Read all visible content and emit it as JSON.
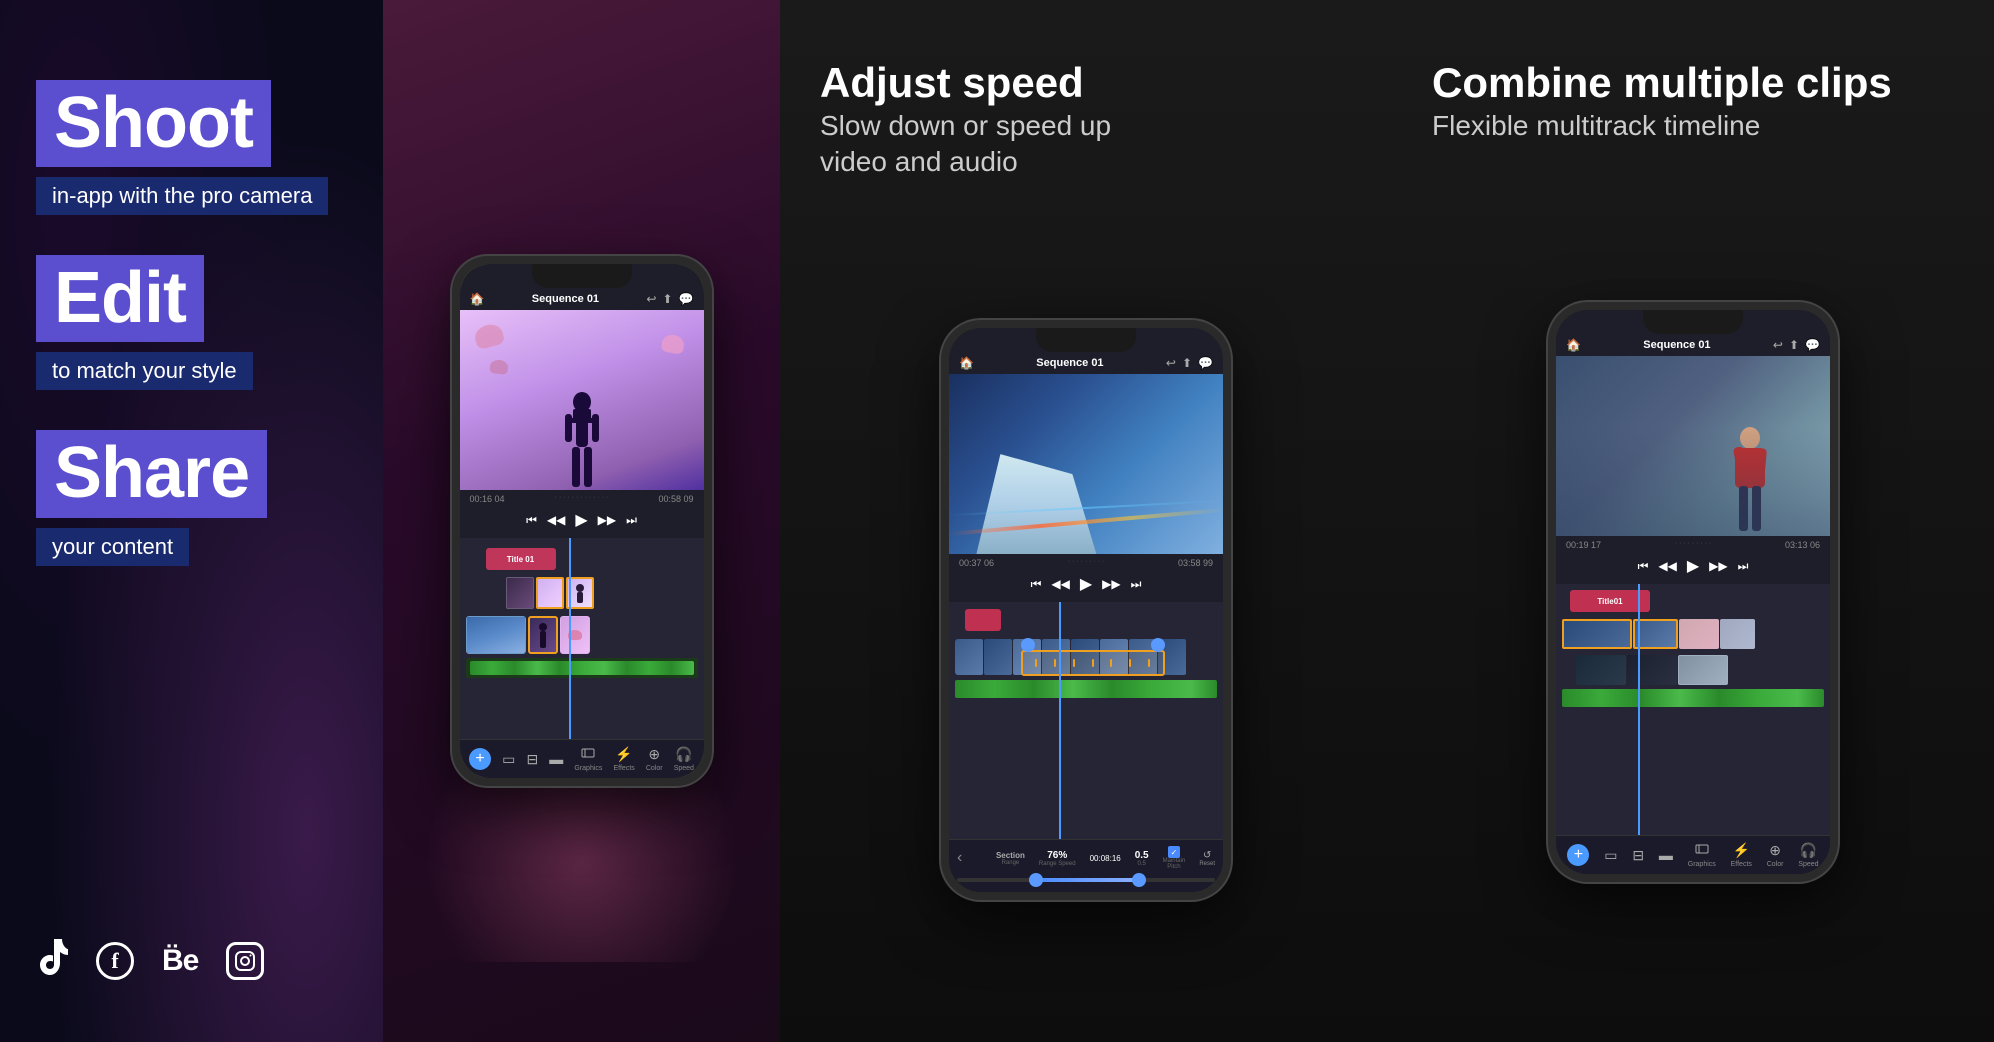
{
  "panel1": {
    "hero1_label": "Shoot",
    "hero1_sub": "in-app with the pro camera",
    "hero2_label": "Edit",
    "hero2_sub": "to match your style",
    "hero3_label": "Share",
    "hero3_sub": "your content",
    "social_icons": [
      "tiktok",
      "facebook",
      "behance",
      "instagram"
    ]
  },
  "panel2": {
    "phone": {
      "header_title": "Sequence 01",
      "time_display": "00:16 04",
      "duration_display": "00:58 09",
      "title_track": "Title 01",
      "toolbar_items": [
        "Graphics",
        "Effects",
        "Color",
        "Speed"
      ]
    }
  },
  "panel3": {
    "title_bold": "Adjust speed",
    "title_light1": "Slow down or speed up",
    "title_light2": "video and audio",
    "phone": {
      "header_title": "Sequence 01",
      "time_display": "00:37 06",
      "duration_display": "03:58 99",
      "section_label": "Section",
      "range_label": "Range",
      "speed_value": "76%",
      "time2": "00:08:16",
      "ramp_value": "0.5",
      "maintain_pitch_label": "Maintain Pitch",
      "reset_label": "Reset"
    }
  },
  "panel4": {
    "title_bold": "Combine multiple clips",
    "title_light": "Flexible multitrack timeline",
    "phone": {
      "header_title": "Sequence 01",
      "time_display": "00:19 17",
      "duration_display": "03:13 06",
      "title_track": "Title01",
      "toolbar_items": [
        "Graphics",
        "Effects",
        "Color",
        "Speed"
      ]
    }
  }
}
